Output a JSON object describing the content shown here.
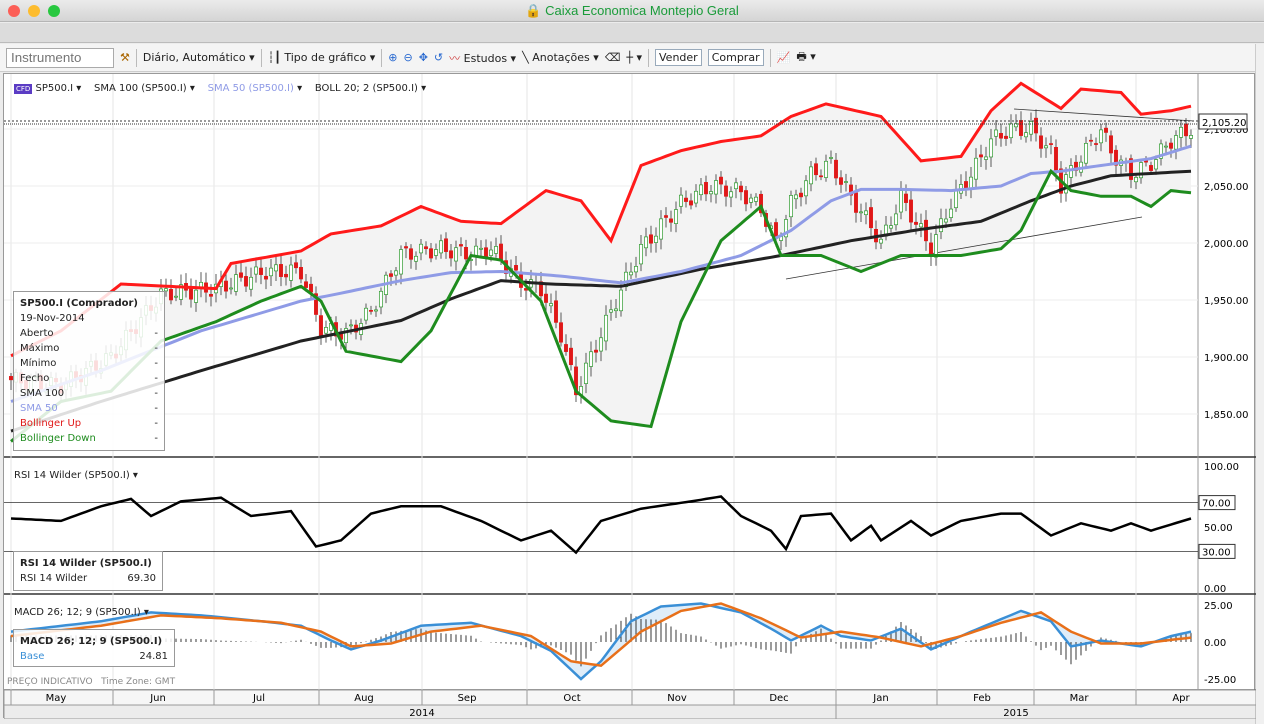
{
  "window": {
    "title": "Caixa Economica Montepio Geral"
  },
  "toolbar": {
    "instrument_placeholder": "Instrumento",
    "interval": "Diário, Automático",
    "chart_type": "Tipo de gráfico",
    "studies": "Estudos",
    "annotations": "Anotações",
    "sell": "Vender",
    "buy": "Comprar"
  },
  "chart_header": {
    "symbol": "SP500.I",
    "sma100": "SMA 100 (SP500.I)",
    "sma50": "SMA 50 (SP500.I)",
    "boll": "BOLL 20; 2 (SP500.I)"
  },
  "price_legend": {
    "title": "SP500.I (Comprador)",
    "date": "19-Nov-2014",
    "rows": [
      {
        "label": "Aberto",
        "value": "-"
      },
      {
        "label": "Máximo",
        "value": "-"
      },
      {
        "label": "Mínimo",
        "value": "-"
      },
      {
        "label": "Fecho",
        "value": "-"
      },
      {
        "label": "SMA 100",
        "value": "-"
      },
      {
        "label": "SMA 50",
        "value": "-"
      },
      {
        "label": "Bollinger Up",
        "value": "-"
      },
      {
        "label": "Bollinger Down",
        "value": "-"
      }
    ]
  },
  "rsi": {
    "header": "RSI 14 Wilder (SP500.I)",
    "legend_title": "RSI 14 Wilder (SP500.I)",
    "legend_label": "RSI 14 Wilder",
    "legend_value": "69.30"
  },
  "macd": {
    "header": "MACD 26; 12; 9 (SP500.I)",
    "legend_title": "MACD 26; 12; 9 (SP500.I)",
    "legend_label": "Base",
    "legend_value": "24.81"
  },
  "footer": {
    "price_note": "PREÇO INDICATIVO",
    "timezone": "Time Zone: GMT"
  },
  "colors": {
    "up": "#2e9a2e",
    "down": "#e01818",
    "boll_up": "#ff1a1a",
    "boll_down": "#1e8c1e",
    "sma50": "#8f9be6",
    "sma100": "#222222",
    "macd_base": "#3a8fd6",
    "macd_signal": "#e8701a"
  },
  "chart_data": [
    {
      "type": "candlestick",
      "title": "SP500.I",
      "x_unit": "trading day index",
      "ylim": [
        1800,
        2140
      ],
      "y_ticks": [
        "2,100.00",
        "2,050.00",
        "2,000.00",
        "1,950.00",
        "1,900.00",
        "1,850.00"
      ],
      "y_tick_values": [
        2100,
        2050,
        2000,
        1950,
        1900,
        1850
      ],
      "last_price": "2,105.20",
      "close": [
        [
          0,
          1880
        ],
        [
          10,
          1875
        ],
        [
          20,
          1900
        ],
        [
          30,
          1955
        ],
        [
          41,
          1960
        ],
        [
          51,
          1975
        ],
        [
          58,
          1975
        ],
        [
          62,
          1925
        ],
        [
          67,
          1920
        ],
        [
          72,
          1940
        ],
        [
          78,
          1990
        ],
        [
          86,
          1995
        ],
        [
          92,
          1990
        ],
        [
          96,
          1995
        ],
        [
          102,
          1965
        ],
        [
          106,
          1960
        ],
        [
          110,
          1920
        ],
        [
          113,
          1870
        ],
        [
          116,
          1900
        ],
        [
          120,
          1940
        ],
        [
          126,
          1995
        ],
        [
          134,
          2035
        ],
        [
          140,
          2050
        ],
        [
          146,
          2045
        ],
        [
          150,
          2030
        ],
        [
          153,
          2000
        ],
        [
          156,
          2035
        ],
        [
          160,
          2060
        ],
        [
          164,
          2070
        ],
        [
          168,
          2040
        ],
        [
          172,
          2015
        ],
        [
          174,
          2000
        ],
        [
          178,
          2040
        ],
        [
          184,
          1995
        ],
        [
          188,
          2035
        ],
        [
          192,
          2060
        ],
        [
          196,
          2090
        ],
        [
          200,
          2100
        ],
        [
          204,
          2100
        ],
        [
          208,
          2080
        ],
        [
          210,
          2050
        ],
        [
          214,
          2075
        ],
        [
          218,
          2100
        ],
        [
          220,
          2080
        ],
        [
          224,
          2060
        ],
        [
          228,
          2070
        ],
        [
          232,
          2090
        ],
        [
          236,
          2100
        ]
      ],
      "boll_up": [
        [
          0,
          1901
        ],
        [
          10,
          1923
        ],
        [
          22,
          1964
        ],
        [
          41,
          1960
        ],
        [
          44,
          1982
        ],
        [
          58,
          1993
        ],
        [
          64,
          2008
        ],
        [
          74,
          2015
        ],
        [
          82,
          2032
        ],
        [
          90,
          2019
        ],
        [
          98,
          2017
        ],
        [
          107,
          2046
        ],
        [
          114,
          2037
        ],
        [
          120,
          2002
        ],
        [
          126,
          2068
        ],
        [
          134,
          2081
        ],
        [
          142,
          2089
        ],
        [
          150,
          2094
        ],
        [
          156,
          2111
        ],
        [
          163,
          2122
        ],
        [
          174,
          2111
        ],
        [
          182,
          2072
        ],
        [
          190,
          2076
        ],
        [
          196,
          2116
        ],
        [
          202,
          2140
        ],
        [
          210,
          2118
        ],
        [
          214,
          2135
        ],
        [
          222,
          2132
        ],
        [
          226,
          2113
        ],
        [
          232,
          2116
        ],
        [
          236,
          2120
        ]
      ],
      "boll_down": [
        [
          0,
          1826
        ],
        [
          10,
          1861
        ],
        [
          20,
          1870
        ],
        [
          30,
          1914
        ],
        [
          41,
          1931
        ],
        [
          50,
          1949
        ],
        [
          58,
          1962
        ],
        [
          62,
          1949
        ],
        [
          67,
          1905
        ],
        [
          78,
          1896
        ],
        [
          84,
          1923
        ],
        [
          92,
          1989
        ],
        [
          98,
          1985
        ],
        [
          106,
          1949
        ],
        [
          113,
          1870
        ],
        [
          120,
          1844
        ],
        [
          128,
          1839
        ],
        [
          134,
          1931
        ],
        [
          142,
          2002
        ],
        [
          150,
          2032
        ],
        [
          154,
          1989
        ],
        [
          162,
          1989
        ],
        [
          170,
          1975
        ],
        [
          178,
          1989
        ],
        [
          190,
          1989
        ],
        [
          198,
          1995
        ],
        [
          202,
          2011
        ],
        [
          208,
          2063
        ],
        [
          212,
          2046
        ],
        [
          218,
          2041
        ],
        [
          224,
          2041
        ],
        [
          228,
          2032
        ],
        [
          232,
          2046
        ],
        [
          236,
          2044
        ]
      ],
      "sma50": [
        [
          0,
          1861
        ],
        [
          18,
          1888
        ],
        [
          38,
          1923
        ],
        [
          58,
          1949
        ],
        [
          66,
          1956
        ],
        [
          78,
          1967
        ],
        [
          88,
          1974
        ],
        [
          98,
          1975
        ],
        [
          110,
          1971
        ],
        [
          122,
          1965
        ],
        [
          134,
          1975
        ],
        [
          146,
          1989
        ],
        [
          156,
          2011
        ],
        [
          164,
          2037
        ],
        [
          170,
          2047
        ],
        [
          178,
          2047
        ],
        [
          188,
          2046
        ],
        [
          198,
          2050
        ],
        [
          204,
          2061
        ],
        [
          210,
          2063
        ],
        [
          218,
          2068
        ],
        [
          228,
          2074
        ],
        [
          236,
          2085
        ]
      ],
      "sma100": [
        [
          0,
          1835
        ],
        [
          18,
          1861
        ],
        [
          38,
          1888
        ],
        [
          58,
          1914
        ],
        [
          78,
          1932
        ],
        [
          88,
          1951
        ],
        [
          98,
          1967
        ],
        [
          108,
          1964
        ],
        [
          122,
          1962
        ],
        [
          138,
          1977
        ],
        [
          154,
          1989
        ],
        [
          168,
          2002
        ],
        [
          182,
          2012
        ],
        [
          194,
          2019
        ],
        [
          204,
          2037
        ],
        [
          212,
          2050
        ],
        [
          220,
          2059
        ],
        [
          236,
          2063
        ]
      ]
    },
    {
      "type": "line",
      "title": "RSI 14 Wilder",
      "ylim": [
        0,
        100
      ],
      "y_ticks": [
        "100.00",
        "50.00",
        "0.00"
      ],
      "levels": [
        "70.00",
        "30.00"
      ],
      "level_values": [
        70,
        30
      ],
      "values": [
        [
          0,
          57
        ],
        [
          10,
          55
        ],
        [
          18,
          67
        ],
        [
          24,
          73
        ],
        [
          28,
          59
        ],
        [
          34,
          71
        ],
        [
          42,
          74
        ],
        [
          48,
          59
        ],
        [
          56,
          63
        ],
        [
          61,
          34
        ],
        [
          66,
          39
        ],
        [
          72,
          61
        ],
        [
          78,
          67
        ],
        [
          86,
          67
        ],
        [
          94,
          55
        ],
        [
          98,
          47
        ],
        [
          102,
          39
        ],
        [
          108,
          47
        ],
        [
          113,
          29
        ],
        [
          118,
          55
        ],
        [
          126,
          65
        ],
        [
          136,
          71
        ],
        [
          142,
          75
        ],
        [
          146,
          59
        ],
        [
          152,
          47
        ],
        [
          155,
          32
        ],
        [
          158,
          59
        ],
        [
          164,
          61
        ],
        [
          168,
          39
        ],
        [
          172,
          51
        ],
        [
          174,
          39
        ],
        [
          180,
          55
        ],
        [
          184,
          43
        ],
        [
          190,
          55
        ],
        [
          198,
          61
        ],
        [
          202,
          61
        ],
        [
          208,
          43
        ],
        [
          214,
          53
        ],
        [
          220,
          47
        ],
        [
          224,
          53
        ],
        [
          228,
          47
        ],
        [
          236,
          57
        ]
      ]
    },
    {
      "type": "line",
      "title": "MACD 26; 12; 9",
      "ylim": [
        -25,
        25
      ],
      "y_ticks": [
        "25.00",
        "0.00",
        "-25.00"
      ],
      "y_tick_values": [
        25,
        0,
        -25
      ],
      "base": [
        [
          0,
          7
        ],
        [
          18,
          14
        ],
        [
          28,
          20
        ],
        [
          38,
          18
        ],
        [
          50,
          14
        ],
        [
          58,
          11
        ],
        [
          64,
          1
        ],
        [
          68,
          -5
        ],
        [
          74,
          1
        ],
        [
          82,
          11
        ],
        [
          92,
          13
        ],
        [
          102,
          4
        ],
        [
          108,
          -6
        ],
        [
          114,
          -25
        ],
        [
          118,
          -13
        ],
        [
          124,
          14
        ],
        [
          130,
          24
        ],
        [
          138,
          26
        ],
        [
          146,
          20
        ],
        [
          152,
          9
        ],
        [
          156,
          1
        ],
        [
          162,
          11
        ],
        [
          166,
          4
        ],
        [
          172,
          1
        ],
        [
          178,
          9
        ],
        [
          184,
          -5
        ],
        [
          192,
          7
        ],
        [
          202,
          21
        ],
        [
          208,
          14
        ],
        [
          212,
          -3
        ],
        [
          218,
          1
        ],
        [
          226,
          -3
        ],
        [
          232,
          4
        ],
        [
          236,
          7
        ]
      ],
      "signal": [
        [
          0,
          4
        ],
        [
          18,
          11
        ],
        [
          30,
          18
        ],
        [
          42,
          16
        ],
        [
          54,
          13
        ],
        [
          62,
          7
        ],
        [
          68,
          -3
        ],
        [
          76,
          -1
        ],
        [
          84,
          7
        ],
        [
          94,
          11
        ],
        [
          104,
          4
        ],
        [
          112,
          -13
        ],
        [
          118,
          -16
        ],
        [
          126,
          7
        ],
        [
          134,
          21
        ],
        [
          142,
          26
        ],
        [
          150,
          16
        ],
        [
          158,
          3
        ],
        [
          166,
          7
        ],
        [
          174,
          3
        ],
        [
          182,
          -3
        ],
        [
          190,
          4
        ],
        [
          198,
          13
        ],
        [
          206,
          20
        ],
        [
          212,
          7
        ],
        [
          218,
          -1
        ],
        [
          226,
          -1
        ],
        [
          236,
          3
        ]
      ]
    },
    {
      "type": "axis",
      "months": [
        "May",
        "Jun",
        "Jul",
        "Aug",
        "Sep",
        "Oct",
        "Nov",
        "Dec",
        "Jan",
        "Feb",
        "Mar",
        "Apr"
      ],
      "years": [
        "2014",
        "2015"
      ]
    }
  ]
}
